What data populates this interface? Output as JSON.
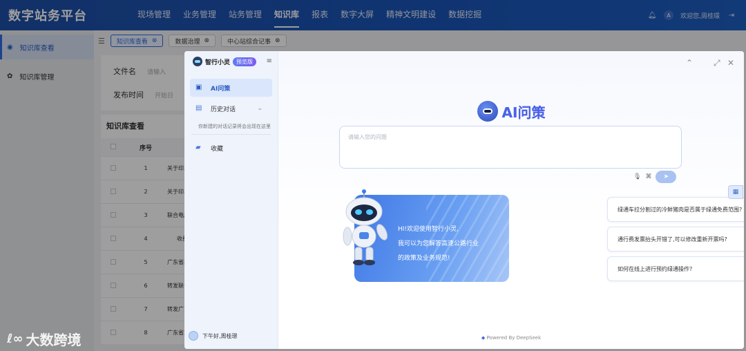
{
  "app": {
    "title": "数字站务平台"
  },
  "nav": {
    "items": [
      "现场管理",
      "业务管理",
      "站务管理",
      "知识库",
      "报表",
      "数字大屏",
      "精神文明建设",
      "数据挖掘"
    ],
    "active_index": 3
  },
  "header": {
    "greeting": "欢迎您,周桂璟",
    "user_initial": "A",
    "icons": [
      "bell-icon",
      "user-icon",
      "logout-icon"
    ]
  },
  "sidebar": {
    "items": [
      {
        "label": "知识库查看",
        "icon": "eye-icon",
        "active": true
      },
      {
        "label": "知识库管理",
        "icon": "gear-icon",
        "active": false
      }
    ]
  },
  "tabs": {
    "items": [
      "知识库查看",
      "数据治理",
      "中心站综合记事"
    ],
    "active_index": 0
  },
  "filters": {
    "file_name_label": "文件名",
    "file_name_placeholder": "请输入",
    "publish_time_label": "发布时间",
    "publish_time_placeholder": "开始日"
  },
  "list": {
    "title": "知识库查看",
    "columns": [
      "序号"
    ],
    "rows": [
      {
        "no": "1",
        "title": "关于印发《"
      },
      {
        "no": "2",
        "title": "关于印发《"
      },
      {
        "no": "3",
        "title": "联合电服公"
      },
      {
        "no": "4",
        "title": "收费标"
      },
      {
        "no": "5",
        "title": "广东省高速"
      },
      {
        "no": "6",
        "title": "转发联合电"
      },
      {
        "no": "7",
        "title": "转发广东利"
      },
      {
        "no": "8",
        "title": "广东省交通"
      }
    ]
  },
  "dialog": {
    "app_name": "智行小灵",
    "badge": "预览版",
    "menu": {
      "ai_label": "AI问策",
      "history_label": "历史对话",
      "history_hint": "你新建的对话记录将会出现在这里",
      "favorites_label": "收藏"
    },
    "user_greeting": "下午好,周桂璟",
    "title": "AI问策",
    "input_placeholder": "请输入您的问题",
    "banner_lines": [
      "HI!欢迎使用智行小灵,",
      "我可以为您解答高速公路行业",
      "的政策及业务规范!"
    ],
    "suggestions": [
      "绿通车拉分割过的冷鲜猪肉是否属于绿通免费范围?",
      "通行费发票抬头开错了,可以修改重新开票吗?",
      "如何在线上进行预约绿通操作?"
    ],
    "powered_by": "Powered By DeepSeek"
  },
  "watermark": {
    "text": "大数跨境"
  },
  "colors": {
    "primary": "#2f6be0",
    "header": "#1e55b3",
    "accent": "#6c5ef0"
  }
}
